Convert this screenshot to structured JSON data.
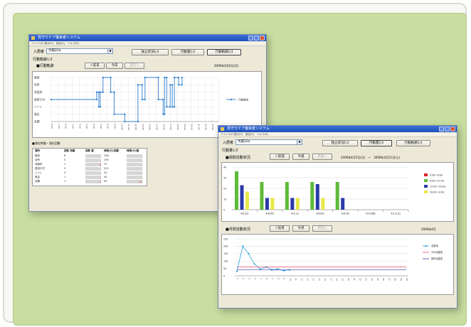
{
  "window1": {
    "title": "見守りケア優良者システム",
    "menu": [
      "ファイル(F)",
      "表示(V)",
      "設定(S)",
      "ヘルプ(H)"
    ],
    "resident_label": "入居者",
    "resident_value": "大越22a",
    "buttons": {
      "status": "独立状況ﾓﾆﾀ",
      "heatmap": "行動量ﾓﾆﾀ",
      "track": "行動軌跡ﾓﾆﾀ"
    },
    "section_title": "行動軌跡ﾓﾆﾀ",
    "graph_title": "■行動軌跡",
    "nav": {
      "prev": "＜前日",
      "today": "今日",
      "next": "翌日＞"
    },
    "date_text": "2009年4月6日(月)",
    "y_labels": [
      "寝室",
      "台所",
      "洗面所",
      "居室口付",
      "トイレ",
      "風呂",
      "玄関"
    ],
    "legend": "行動軌跡",
    "time_labels": [
      "0:00",
      "1:00",
      "2:00",
      "3:00",
      "4:00",
      "5:00",
      "6:00",
      "7:00",
      "8:00",
      "9:00",
      "10:00",
      "11:00",
      "12:00",
      "13:00",
      "14:00",
      "15:00",
      "16:00",
      "17:00",
      "18:00",
      "19:00",
      "20:00",
      "21:00",
      "22:00",
      "23:00"
    ],
    "trajectory": {
      "x": [
        0,
        6.5,
        6.5,
        6.8,
        6.8,
        7.0,
        7.0,
        7.4,
        7.4,
        8.5,
        8.5,
        9.0,
        9.0,
        10.5,
        10.5,
        12.4,
        12.4,
        13.0,
        13.0,
        13.4,
        13.4,
        15.3,
        15.3,
        16.0,
        16.0,
        16.2,
        16.2,
        16.5,
        16.5,
        17.0,
        17.0,
        17.3,
        17.3,
        17.6,
        17.6,
        18.2,
        18.2,
        18.7,
        18.7
      ],
      "y": [
        3,
        3,
        2,
        2,
        4,
        4,
        2,
        2,
        0,
        0,
        2,
        2,
        5,
        5,
        6,
        6,
        1,
        1,
        3,
        3,
        0,
        0,
        3,
        3,
        5,
        5,
        0,
        0,
        4,
        4,
        1,
        1,
        4,
        4,
        0,
        0,
        1,
        1,
        0
      ]
    },
    "table_title": "■滞在時間・滞在回数",
    "table_headers": [
      "場所",
      "回数 実績",
      "回数 差",
      "時間(分)実績",
      "時間(分)差"
    ],
    "table_rows": [
      [
        "寝室",
        "6",
        "-",
        "246",
        "-"
      ],
      [
        "台所",
        "5",
        "-",
        "195",
        "-"
      ],
      [
        "洗面所",
        "1",
        "8",
        "73",
        "-"
      ],
      [
        "居室口付",
        "3",
        "-",
        "221",
        "-"
      ],
      [
        "トイレ",
        "4",
        "-",
        "41",
        "-"
      ],
      [
        "風呂",
        "1",
        "-",
        "44",
        "-"
      ],
      [
        "玄関",
        "1",
        "2",
        "50",
        "50"
      ]
    ]
  },
  "window2": {
    "title": "見守りケア優良者システム",
    "menu": [
      "ファイル(F)",
      "表示(V)",
      "設定(S)",
      "ヘルプ(H)"
    ],
    "resident_label": "入居者",
    "resident_value": "大越22a",
    "buttons": {
      "status": "独立状況ﾓﾆﾀ",
      "heatmap": "行動量ﾓﾆﾀ",
      "track": "行動軌跡ﾓﾆﾀ"
    },
    "section_title": "行動量ﾓﾆﾀ",
    "weekly_title": "■週間活動状況",
    "weekly_nav": {
      "prev": "＜前週",
      "current": "今週",
      "next": "翌週＞"
    },
    "weekly_range": "2009年4月5日(日)　～　2009年4月11日(土)",
    "monthly_title": "■月間活動状況",
    "monthly_nav": {
      "prev": "＜前月",
      "current": "今月",
      "next": "翌月＞"
    },
    "month_text": "2009年4月",
    "colors": {
      "green": "#5dbb3a",
      "navy": "#2a3aa8",
      "yellow": "#e8e84a",
      "red": "#d8262a",
      "cyan": "#2aa3d8",
      "pink": "#e04a7a",
      "purple": "#3a3aa8"
    }
  },
  "chart_data": [
    {
      "type": "bar",
      "title": "週間活動状況",
      "categories": [
        "4/5(日)",
        "4/6(月)",
        "4/7(火)",
        "4/8(水)",
        "4/9(木)",
        "4/10(金)",
        "4/11(土)"
      ],
      "ylim": [
        0,
        40
      ],
      "yticks": [
        0,
        10,
        20,
        30,
        40
      ],
      "series": [
        {
          "name": "0:00～6:00",
          "color": "#d8262a",
          "values": [
            0,
            0,
            0,
            0,
            0,
            0,
            0
          ]
        },
        {
          "name": "6:00～12:00",
          "color": "#5dbb3a",
          "values": [
            36,
            26,
            26,
            26,
            26,
            0,
            0
          ]
        },
        {
          "name": "12:00～18:00",
          "color": "#2a3aa8",
          "values": [
            23,
            11,
            11,
            24,
            11,
            0,
            0
          ]
        },
        {
          "name": "18:00～0:00",
          "color": "#e8e84a",
          "values": [
            17,
            11,
            11,
            11,
            0,
            0,
            0
          ]
        }
      ],
      "legend_position": "right"
    },
    {
      "type": "line",
      "title": "月間活動状況",
      "x": [
        1,
        2,
        3,
        4,
        5,
        6,
        7,
        8,
        9,
        10,
        11,
        12,
        13,
        14,
        15,
        16,
        17,
        18,
        19,
        20,
        21,
        22,
        23,
        24,
        25,
        26,
        27,
        28,
        29,
        30
      ],
      "ylim": [
        0,
        250
      ],
      "yticks": [
        0,
        50,
        100,
        150,
        200,
        250
      ],
      "series": [
        {
          "name": "活動量",
          "color": "#2aa3d8",
          "values": [
            30,
            200,
            150,
            80,
            45,
            60,
            40,
            45,
            35,
            40,
            null,
            null,
            null,
            null,
            null,
            null,
            null,
            null,
            null,
            null,
            null,
            null,
            null,
            null,
            null,
            null,
            null,
            null,
            null,
            null
          ]
        },
        {
          "name": "平均活動量",
          "color": "#e04a7a",
          "values": [
            60,
            60,
            60,
            60,
            60,
            60,
            60,
            60,
            60,
            60,
            60,
            60,
            60,
            60,
            60,
            60,
            60,
            60,
            60,
            60,
            60,
            60,
            60,
            60,
            60,
            60,
            60,
            60,
            60,
            60
          ]
        },
        {
          "name": "基準活動量",
          "color": "#3a3aa8",
          "values": [
            40,
            40,
            40,
            40,
            40,
            40,
            40,
            40,
            40,
            40,
            40,
            40,
            40,
            40,
            40,
            40,
            40,
            40,
            40,
            40,
            40,
            40,
            40,
            40,
            40,
            40,
            40,
            40,
            40,
            40
          ]
        }
      ],
      "legend_position": "right"
    }
  ]
}
